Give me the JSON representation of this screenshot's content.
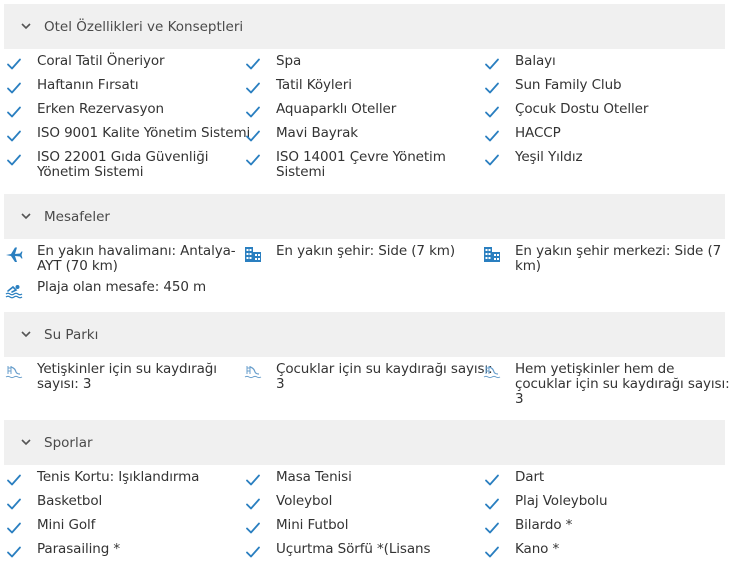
{
  "accent_color": "#2a7fc0",
  "sections": [
    {
      "title": "Otel Özellikleri ve Konseptleri",
      "items": [
        {
          "icon": "check-icon",
          "text": "Coral Tatil Öneriyor"
        },
        {
          "icon": "check-icon",
          "text": "Spa"
        },
        {
          "icon": "check-icon",
          "text": "Balayı"
        },
        {
          "icon": "check-icon",
          "text": "Haftanın Fırsatı"
        },
        {
          "icon": "check-icon",
          "text": "Tatil Köyleri"
        },
        {
          "icon": "check-icon",
          "text": "Sun Family Club"
        },
        {
          "icon": "check-icon",
          "text": "Erken Rezervasyon"
        },
        {
          "icon": "check-icon",
          "text": "Aquaparklı Oteller"
        },
        {
          "icon": "check-icon",
          "text": "Çocuk Dostu Oteller"
        },
        {
          "icon": "check-icon",
          "text": "ISO 9001 Kalite Yönetim Sistemi"
        },
        {
          "icon": "check-icon",
          "text": "Mavi Bayrak"
        },
        {
          "icon": "check-icon",
          "text": "HACCP"
        },
        {
          "icon": "check-icon",
          "text": "ISO 22001 Gıda Güvenliği\nYönetim Sistemi"
        },
        {
          "icon": "check-icon",
          "text": "ISO 14001 Çevre Yönetim\nSistemi"
        },
        {
          "icon": "check-icon",
          "text": "Yeşil Yıldız"
        }
      ]
    },
    {
      "title": "Mesafeler",
      "items": [
        {
          "icon": "airplane-icon",
          "text": "En yakın havalimanı: Antalya-\nAYT (70 km)"
        },
        {
          "icon": "city-icon",
          "text": "En yakın şehir: Side (7 km)"
        },
        {
          "icon": "city-icon",
          "text": "En yakın şehir merkezi: Side (7\nkm)"
        },
        {
          "icon": "swimmer-icon",
          "text": "Plaja olan mesafe: 450 m"
        }
      ]
    },
    {
      "title": "Su Parkı",
      "items": [
        {
          "icon": "water-slide-icon",
          "text": "Yetişkinler için su kaydırağı\nsayısı: 3"
        },
        {
          "icon": "water-slide-icon",
          "text": "Çocuklar için su kaydırağı sayısı:\n3"
        },
        {
          "icon": "water-slide-icon",
          "text": "Hem yetişkinler hem de\nçocuklar için su kaydırağı sayısı:\n3"
        }
      ]
    },
    {
      "title": "Sporlar",
      "items": [
        {
          "icon": "check-icon",
          "text": "Tenis Kortu: Işıklandırma"
        },
        {
          "icon": "check-icon",
          "text": "Masa Tenisi"
        },
        {
          "icon": "check-icon",
          "text": "Dart"
        },
        {
          "icon": "check-icon",
          "text": "Basketbol"
        },
        {
          "icon": "check-icon",
          "text": "Voleybol"
        },
        {
          "icon": "check-icon",
          "text": "Plaj Voleybolu"
        },
        {
          "icon": "check-icon",
          "text": "Mini Golf"
        },
        {
          "icon": "check-icon",
          "text": "Mini Futbol"
        },
        {
          "icon": "check-icon",
          "text": "Bilardo *"
        },
        {
          "icon": "check-icon",
          "text": "Parasailing *"
        },
        {
          "icon": "check-icon",
          "text": "Uçurtma Sörfü *(Lisans"
        },
        {
          "icon": "check-icon",
          "text": "Kano *"
        }
      ]
    }
  ]
}
